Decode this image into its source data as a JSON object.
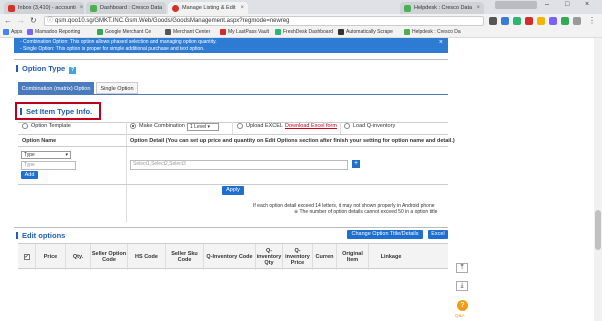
{
  "browser": {
    "tabs": [
      {
        "label": "Inbox (3,410) - accounti",
        "color": "#d93025",
        "icon": "gmail-icon"
      },
      {
        "label": "Dashboard : Cresco Data",
        "color": "#4caf50",
        "icon": "page-icon"
      },
      {
        "label": "Manage Listing & Edit",
        "color": "#d93025",
        "icon": "qoo10-icon"
      },
      {
        "label": "Helpdesk : Cresco Data",
        "color": "#4caf50",
        "icon": "page-icon"
      }
    ],
    "profile_label": "",
    "url": "qsm.qoo10.sg/GMKT.INC.Gsm.Web/Goods/GoodsManagement.aspx?regmode=newreg",
    "bookmarks": [
      {
        "label": "Apps",
        "icon": "apps-icon",
        "color": "#4285f4"
      },
      {
        "label": "Mamadoo Reporting",
        "icon": "bookmark-icon",
        "color": "#7b61ff"
      },
      {
        "label": "Google Merchant Ce",
        "icon": "google-icon",
        "color": "#34a853"
      },
      {
        "label": "Merchant Center",
        "icon": "bookmark-icon",
        "color": "#555555"
      },
      {
        "label": "My LastPass Vault",
        "icon": "lastpass-icon",
        "color": "#d32d27"
      },
      {
        "label": "FreshDesk Dashboard",
        "icon": "freshdesk-icon",
        "color": "#2bb673"
      },
      {
        "label": "Automatically Scrape",
        "icon": "bookmark-icon",
        "color": "#333333"
      },
      {
        "label": "Helpdesk : Cresco Da",
        "icon": "page-icon",
        "color": "#4caf50"
      }
    ]
  },
  "notice": {
    "line1": "- Combination Option: This option allows phased selection and managing option quantity.",
    "line2": "- Single Option: This option is proper for simple additional purchase and text option."
  },
  "option_type": {
    "title": "Option Type",
    "help": "?",
    "tabs": [
      "Combination (matrix) Option",
      "Single Option"
    ]
  },
  "set_item": {
    "title": "Set Item Type Info.",
    "radios": {
      "template": "Option Template",
      "make": "Make Combination :",
      "make_value": "1 Level",
      "upload": "Upload EXCEL",
      "upload_link": "Download Excel form",
      "load": "Load Q-inventory"
    },
    "option_name_label": "Option Name",
    "option_detail_label": "Option Detail  (You can set up price and quantity on Edit Options section after finish your setting for option name and detail.)",
    "type_select": "Type",
    "type_input_placeholder": "Type",
    "add_label": "Add",
    "detail_placeholder": "Select1,Select2,Select3",
    "apply_label": "Apply",
    "note1": "If each option detail exceed 14 letters, it may not shown properly in Android phone",
    "note2": "※ The number of option details cannot exceed 50 in a option title"
  },
  "edit_options": {
    "title": "Edit options",
    "change_btn": "Change Option Title/Details",
    "excel_btn": "Excel",
    "columns": [
      "Price",
      "Qty.",
      "Seller Option Code",
      "HS Code",
      "Seller Sku Code",
      "Q-Inventory Code",
      "Q-inventory Qty",
      "Q-inventory Price",
      "Curren",
      "Original Item",
      "Linkage"
    ]
  },
  "side": {
    "top_icon": "collapse-up-icon",
    "down_icon": "collapse-down-icon",
    "help_label": "Q&A"
  }
}
